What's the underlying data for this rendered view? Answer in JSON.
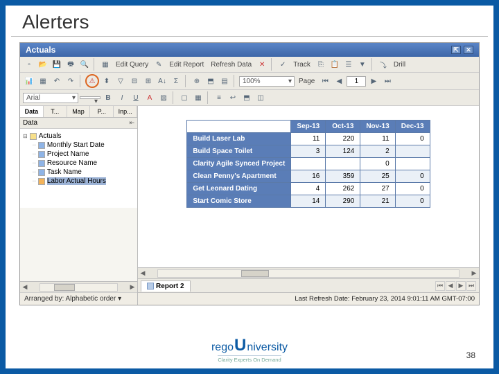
{
  "slide": {
    "title": "Alerters",
    "page_number": "38"
  },
  "brand": {
    "name_prefix": "rego",
    "name_suffix": "niversity",
    "tagline": "Clarity Experts On Demand"
  },
  "app": {
    "title": "Actuals",
    "toolbar1": {
      "edit_query": "Edit Query",
      "edit_report": "Edit Report",
      "refresh_data": "Refresh Data",
      "track": "Track",
      "drill": "Drill"
    },
    "toolbar2": {
      "zoom": "100%",
      "page_label": "Page",
      "page_current": "1"
    },
    "formatbar": {
      "font": "Arial"
    },
    "sidebar": {
      "tabs": [
        "Data",
        "T...",
        "Map",
        "P...",
        "Inp..."
      ],
      "active_tab": 0,
      "header": "Data",
      "tree_root": "Actuals",
      "tree_items": [
        "Monthly Start Date",
        "Project Name",
        "Resource Name",
        "Task Name",
        "Labor Actual Hours"
      ],
      "selected_index": 4,
      "arranger": "Arranged by: Alphabetic order ▾"
    },
    "crosstab": {
      "columns": [
        "Sep-13",
        "Oct-13",
        "Nov-13",
        "Dec-13"
      ],
      "rows": [
        {
          "label": "Build Laser Lab",
          "values": [
            "11",
            "220",
            "11",
            "0"
          ]
        },
        {
          "label": "Build Space Toilet",
          "values": [
            "3",
            "124",
            "2",
            ""
          ]
        },
        {
          "label": "Clarity Agile Synced Project",
          "values": [
            "",
            "",
            "0",
            ""
          ]
        },
        {
          "label": "Clean Penny's Apartment",
          "values": [
            "16",
            "359",
            "25",
            "0"
          ]
        },
        {
          "label": "Get Leonard Dating",
          "values": [
            "4",
            "262",
            "27",
            "0"
          ]
        },
        {
          "label": "Start Comic Store",
          "values": [
            "14",
            "290",
            "21",
            "0"
          ]
        }
      ]
    },
    "report_tab": "Report 2",
    "status": "Last Refresh Date: February 23, 2014 9:01:11 AM GMT-07:00"
  }
}
